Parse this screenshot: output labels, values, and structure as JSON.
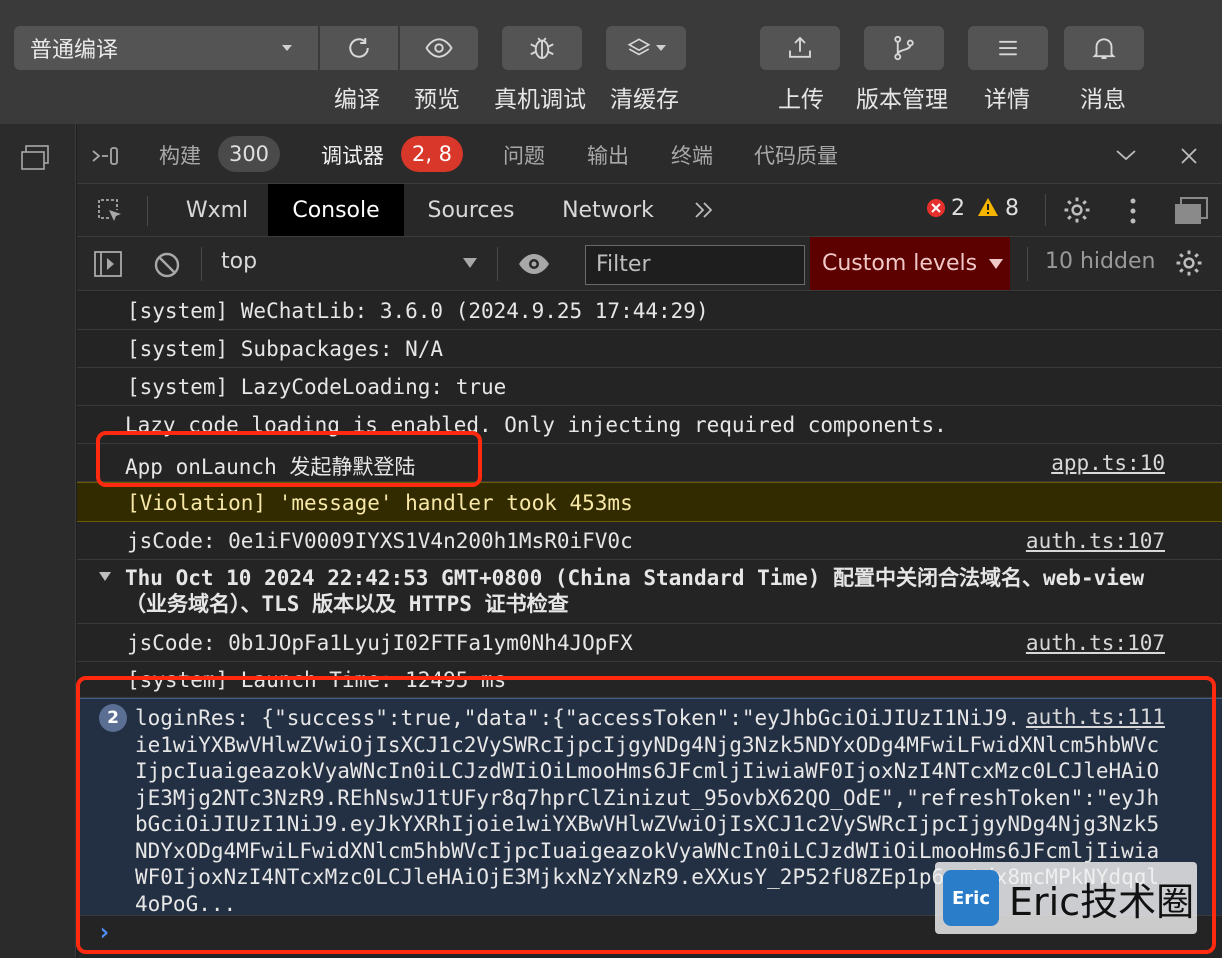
{
  "toolbar": {
    "mode": "普通编译",
    "buttons": [
      {
        "label": "编译",
        "icon": "refresh-icon"
      },
      {
        "label": "预览",
        "icon": "eye-icon"
      },
      {
        "label": "真机调试",
        "icon": "bug-icon"
      },
      {
        "label": "清缓存",
        "icon": "layers-icon"
      },
      {
        "label": "上传",
        "icon": "upload-icon"
      },
      {
        "label": "版本管理",
        "icon": "branch-icon"
      },
      {
        "label": "详情",
        "icon": "menu-icon"
      },
      {
        "label": "消息",
        "icon": "bell-icon"
      }
    ]
  },
  "devtools_tabs": {
    "build": "构建",
    "build_count": "300",
    "debugger": "调试器",
    "debugger_count": "2, 8",
    "issues": "问题",
    "output": "输出",
    "terminal": "终端",
    "quality": "代码质量"
  },
  "panel_tabs": {
    "wxml": "Wxml",
    "console": "Console",
    "sources": "Sources",
    "network": "Network",
    "error_count": "2",
    "warning_count": "8"
  },
  "console_toolbar": {
    "context": "top",
    "filter_placeholder": "Filter",
    "levels": "Custom levels",
    "hidden": "10 hidden"
  },
  "log": [
    {
      "message": "[system] WeChatLib: 3.6.0 (2024.9.25 17:44:29)",
      "source": ""
    },
    {
      "message": "[system] Subpackages: N/A",
      "source": ""
    },
    {
      "message": "[system] LazyCodeLoading: true",
      "source": ""
    },
    {
      "message": "Lazy code loading is enabled. Only injecting required components.",
      "source": ""
    },
    {
      "message": "App onLaunch 发起静默登陆",
      "source": "app.ts:10"
    },
    {
      "message": "[Violation] 'message' handler took 453ms",
      "source": ""
    },
    {
      "message": "jsCode: 0e1iFV0009IYXS1V4n200h1MsR0iFV0c",
      "source": "auth.ts:107"
    },
    {
      "message": "Thu Oct 10 2024 22:42:53 GMT+0800 (China Standard Time) 配置中关闭合法域名、web-view（业务域名）、TLS 版本以及 HTTPS 证书检查",
      "source": ""
    },
    {
      "message": "jsCode: 0b1JOpFa1LyujI02FTFa1ym0Nh4JOpFX",
      "source": "auth.ts:107"
    },
    {
      "message": "[system] Launch Time: 12495 ms",
      "source": ""
    }
  ],
  "login_result": {
    "count": "2",
    "message": "loginRes: {\"success\":true,\"data\":{\"accessToken\":\"eyJhbGciOiJIUzI1NiJ9.eyJkYXRhIjoie1wiYXBwVHlwZVwiOjIsXCJ1c2VySWRcIjpcIjgyNDg4Njg3Nzk5NDYxODg4MFwiLFwidXNlcm5hbWVcIjpcIuaigeazokVyaWNcIn0iLCJzdWIiOiLmooHms6JFcmljIiwiaWF0IjoxNzI4NTcxMzc0LCJleHAiOjE3Mjg2NTc3NzR9.REhNswJ1tUFyr8q7hprClZinizut_95ovbX62QO_OdE\",\"refreshToken\":\"eyJhbGciOiJIUzI1NiJ9.eyJkYXRhIjoie1wiYXBwVHlwZVwiOjIsXCJ1c2VySWRcIjpcIjgyNDg4Njg3Nzk5NDYxODg4MFwiLFwidXNlcm5hbWVcIjpcIuaigeazokVyaWNcIn0iLCJzdWIiOiLmooHms6JFcmljIiwiaWF0IjoxNzI4NTcxMzc0LCJleHAiOjE3MjkxNzYxNzR9.eXXusY_2P52fU8ZEp1p6-ctdx8mcMPkNYdqql4oPoG...",
    "source": "auth.ts:111"
  },
  "watermark": {
    "logo": "Eric",
    "text": "Eric技术圈"
  },
  "colors": {
    "error": "#e5302d",
    "warning": "#f5b400",
    "levels_bg": "#5c0000",
    "highlight": "#ff2a10"
  }
}
